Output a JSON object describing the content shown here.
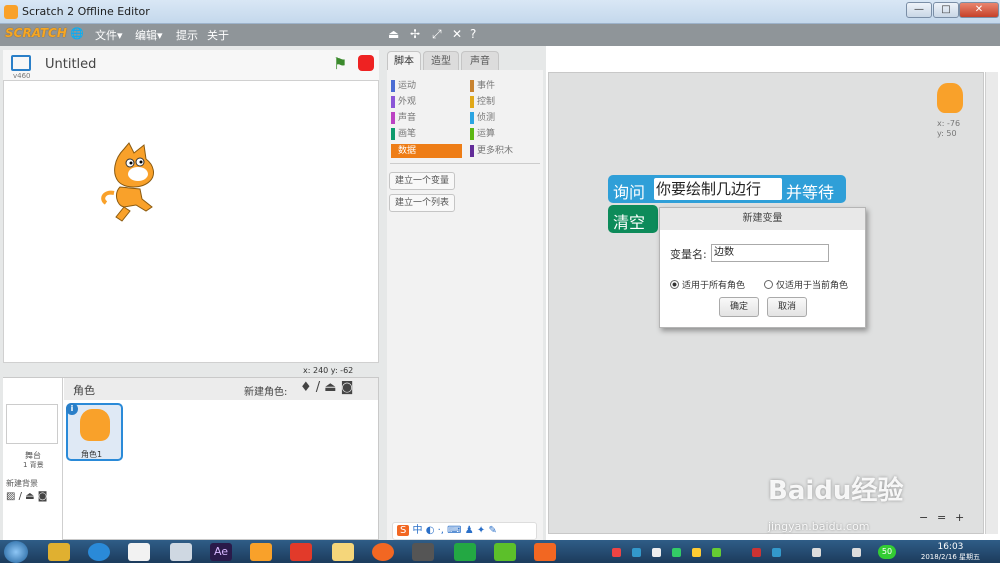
{
  "window": {
    "title": "Scratch 2 Offline Editor",
    "minimize": "—",
    "maximize": "□",
    "close": "✕"
  },
  "menu": {
    "logo": "SCRATCH",
    "file": "文件▾",
    "edit": "编辑▾",
    "tips": "提示",
    "about": "关于"
  },
  "stage": {
    "project_name": "Untitled",
    "version": "v460",
    "coords": "x: 240  y: -62"
  },
  "sprites": {
    "header": "角色",
    "new_sprite": "新建角色:",
    "stage_label": "舞台",
    "backdrops": "1 背景",
    "new_backdrop": "新建背景",
    "sprite1": "角色1"
  },
  "tabs": {
    "scripts": "脚本",
    "costumes": "造型",
    "sounds": "声音"
  },
  "categories": [
    {
      "name": "运动",
      "color": "#4a6cd4"
    },
    {
      "name": "外观",
      "color": "#8a55d7"
    },
    {
      "name": "声音",
      "color": "#bb42c3"
    },
    {
      "name": "画笔",
      "color": "#0e9a6c"
    },
    {
      "name": "数据",
      "color": "#ee7d16"
    },
    {
      "name": "事件",
      "color": "#c88330"
    },
    {
      "name": "控制",
      "color": "#e1a91a"
    },
    {
      "name": "侦测",
      "color": "#2ca5e2"
    },
    {
      "name": "运算",
      "color": "#5cb712"
    },
    {
      "name": "更多积木",
      "color": "#632d99"
    }
  ],
  "palette": {
    "make_variable": "建立一个变量",
    "make_list": "建立一个列表"
  },
  "blocks": {
    "ask": "询问",
    "ask_text": "你要绘制几边行",
    "wait": "并等待",
    "clear": "清空"
  },
  "sprite_info": {
    "x": "x: -76",
    "y": "y: 50"
  },
  "dialog": {
    "title": "新建变量",
    "name_label": "变量名:",
    "name_value": "边数",
    "all_sprites": "适用于所有角色",
    "this_sprite": "仅适用于当前角色",
    "ok": "确定",
    "cancel": "取消"
  },
  "zoom": {
    "out": "−",
    "reset": "=",
    "in": "+"
  },
  "taskbar": {
    "time": "16:03",
    "date": "2018/2/16 星期五",
    "badge": "50"
  },
  "watermark": {
    "brand": "Baidu经验",
    "url": "jingyan.baidu.com"
  }
}
